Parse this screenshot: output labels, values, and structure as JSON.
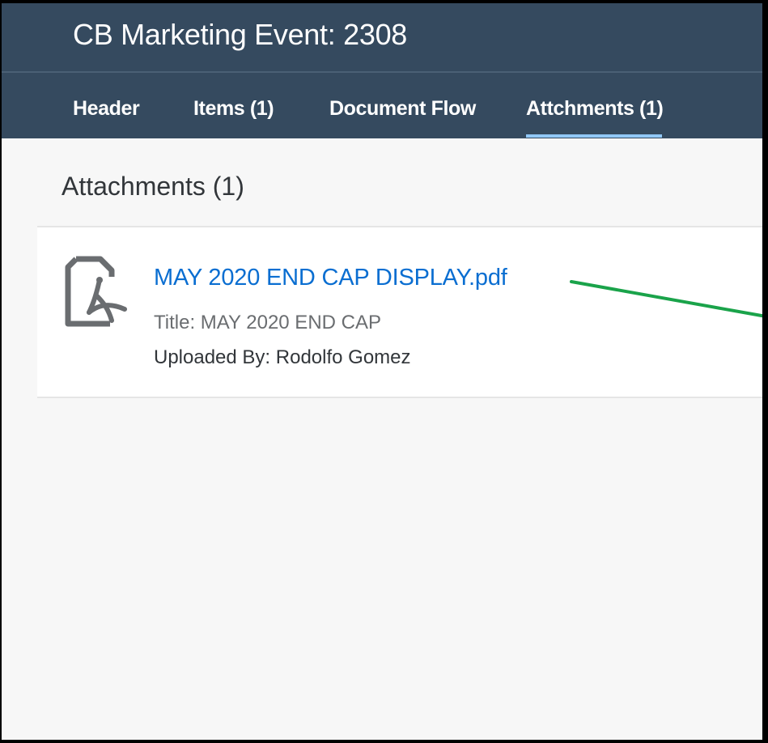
{
  "header": {
    "title": "CB Marketing Event: 2308"
  },
  "tabs": [
    {
      "label": "Header"
    },
    {
      "label": "Items (1)"
    },
    {
      "label": "Document Flow"
    },
    {
      "label": "Attchments (1)",
      "selected": true
    }
  ],
  "attachments": {
    "title": "Attachments (1)",
    "items": [
      {
        "file_name": "MAY 2020 END CAP DISPLAY.pdf",
        "title_line": "Title: MAY 2020 END CAP",
        "uploaded_line": "Uploaded By: Rodolfo Gomez",
        "icon": "pdf-file-icon"
      }
    ]
  },
  "colors": {
    "shell": "#354a5f",
    "link": "#0a6ed1",
    "tab_indicator": "#91c8f6",
    "annotation_arrow": "#1aa34a"
  }
}
